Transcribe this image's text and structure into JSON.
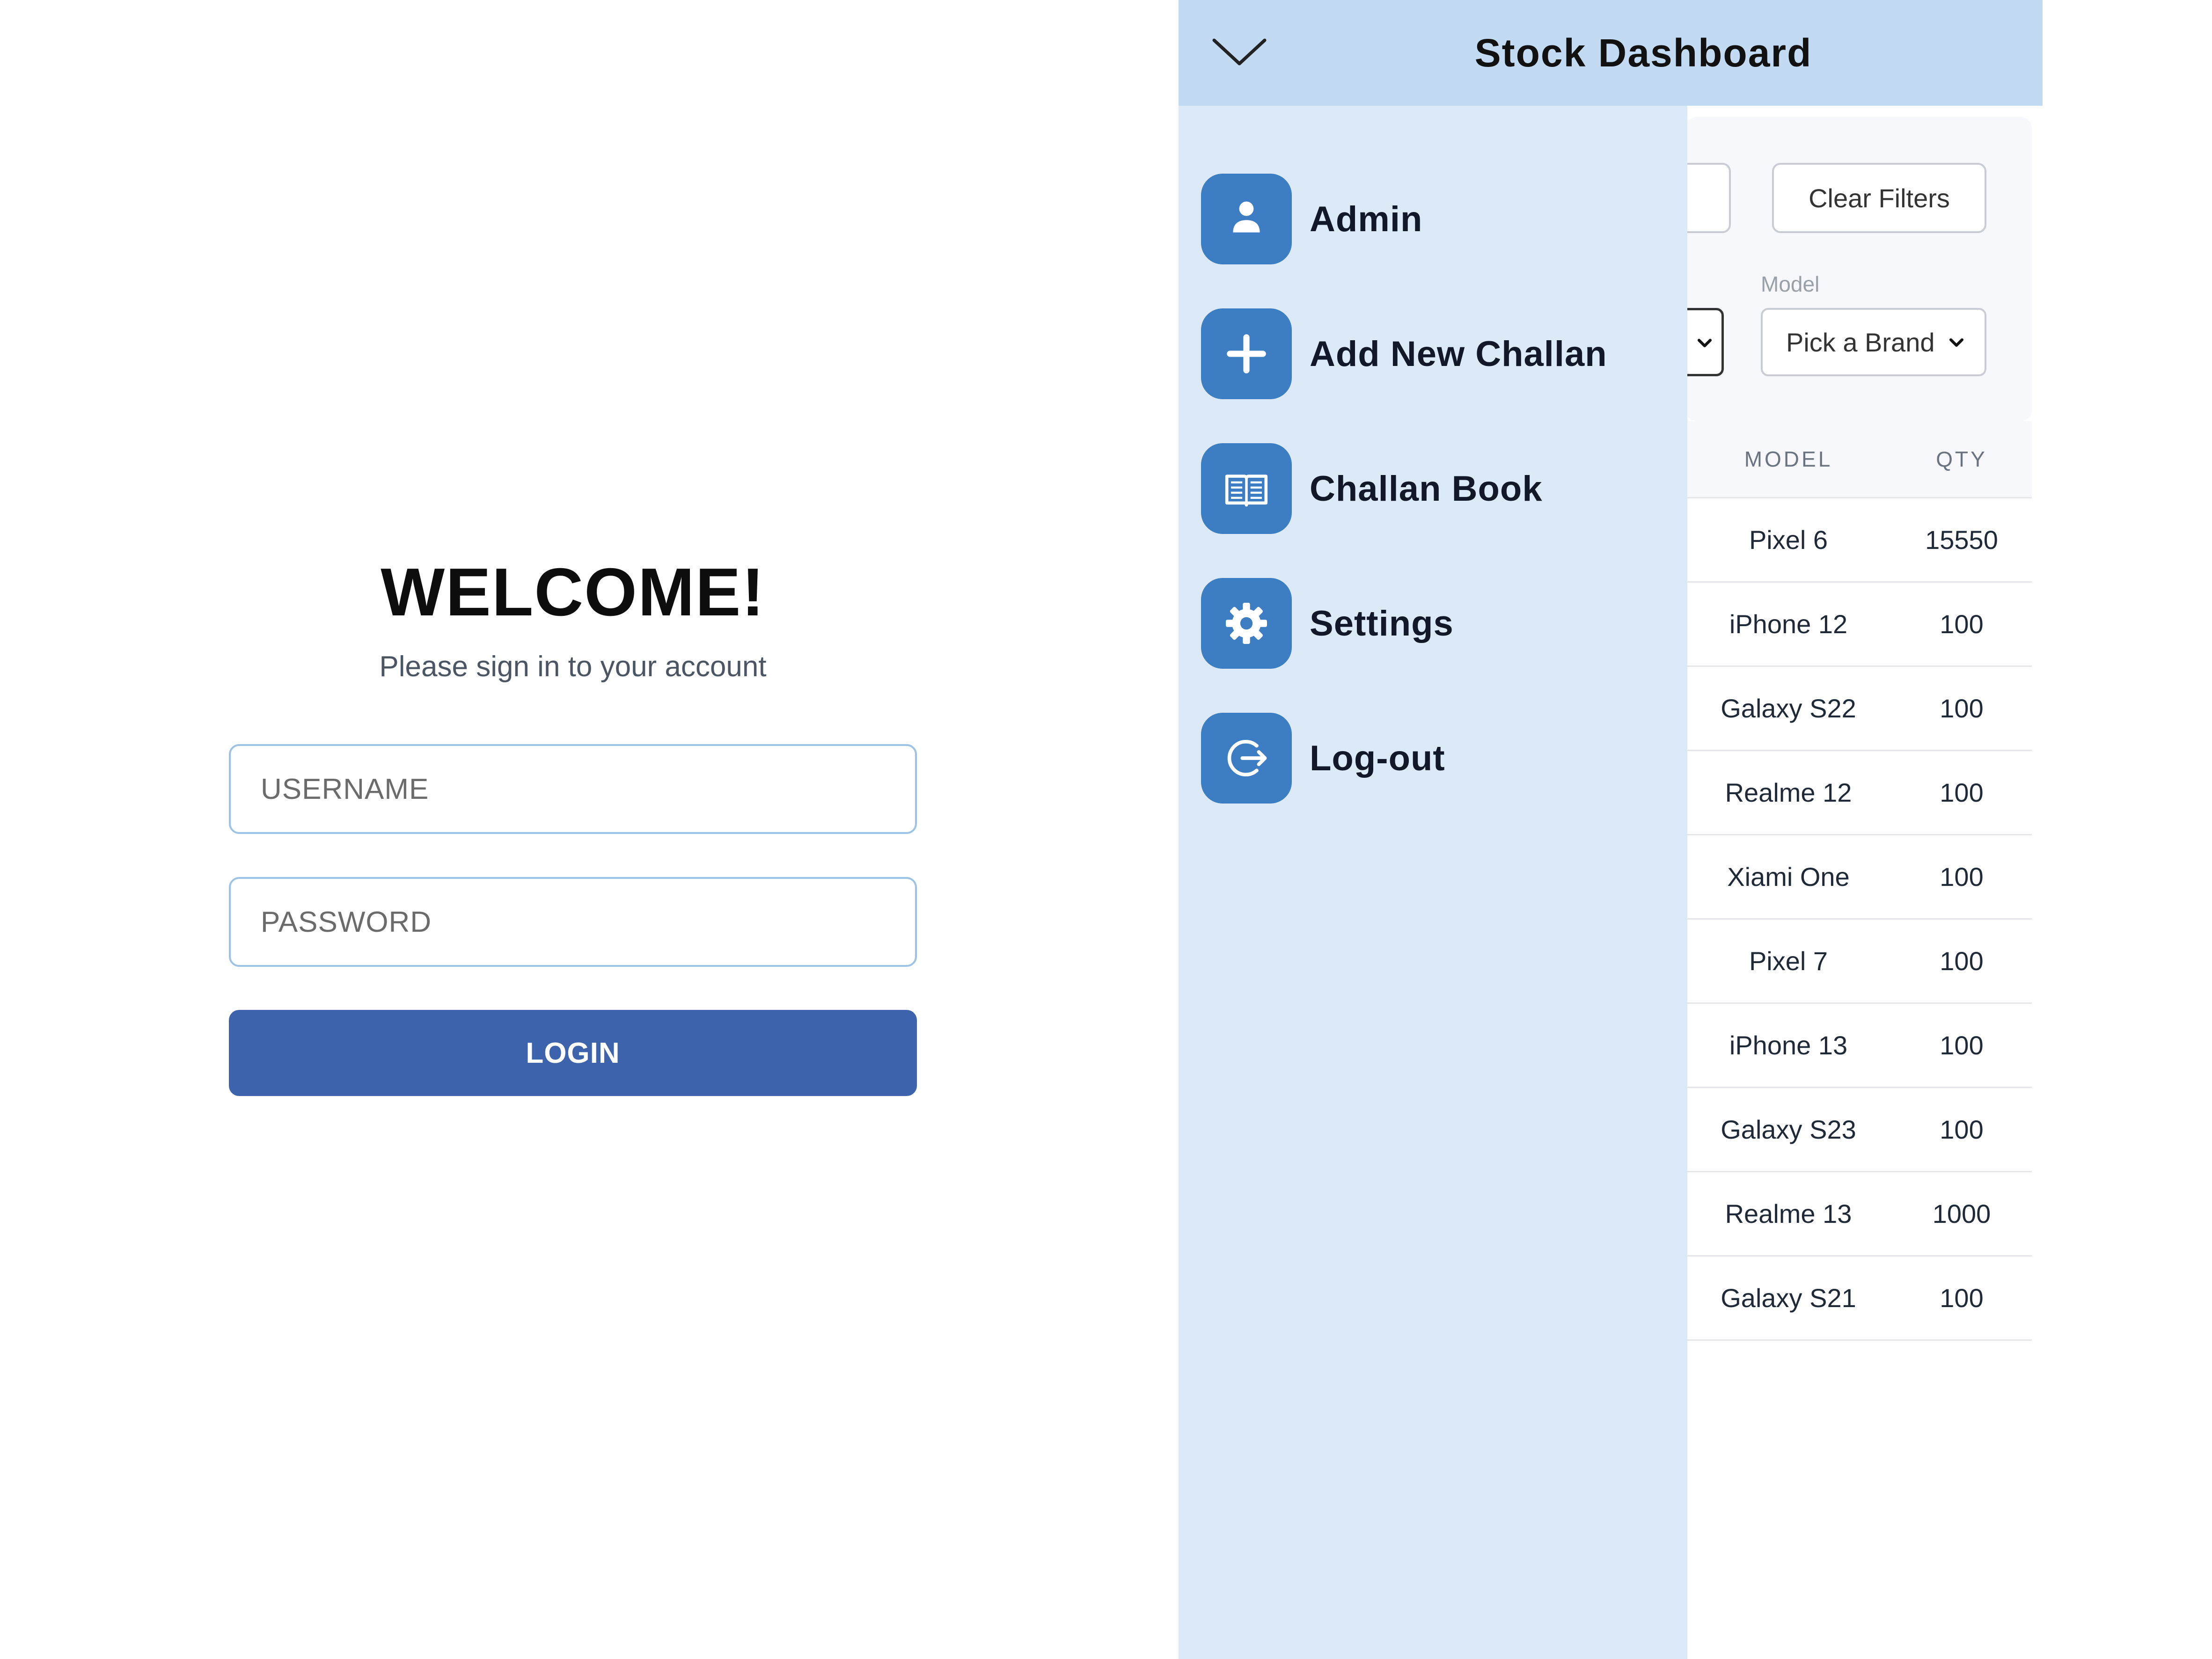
{
  "login": {
    "welcome": "WELCOME!",
    "subtitle": "Please sign in to your account",
    "username_placeholder": "USERNAME",
    "password_placeholder": "PASSWORD",
    "login_label": "LOGIN"
  },
  "dashboard": {
    "title": "Stock Dashboard",
    "clear_filters_label": "Clear Filters",
    "model_label": "Model",
    "model_select_value": "Pick a Brand",
    "table": {
      "headers": {
        "model": "MODEL",
        "qty": "QTY"
      },
      "rows": [
        {
          "model": "Pixel 6",
          "qty": "15550"
        },
        {
          "model": "iPhone 12",
          "qty": "100"
        },
        {
          "model": "Galaxy S22",
          "qty": "100"
        },
        {
          "model": "Realme 12",
          "qty": "100"
        },
        {
          "model": "Xiami One",
          "qty": "100"
        },
        {
          "model": "Pixel 7",
          "qty": "100"
        },
        {
          "model": "iPhone 13",
          "qty": "100"
        },
        {
          "model": "Galaxy S23",
          "qty": "100"
        },
        {
          "model": "Realme 13",
          "qty": "1000"
        },
        {
          "model": "Galaxy S21",
          "qty": "100"
        }
      ]
    }
  },
  "drawer": {
    "items": [
      {
        "label": "Admin",
        "icon": "user-icon"
      },
      {
        "label": "Add New Challan",
        "icon": "plus-icon"
      },
      {
        "label": "Challan Book",
        "icon": "book-icon"
      },
      {
        "label": "Settings",
        "icon": "gear-icon"
      },
      {
        "label": "Log-out",
        "icon": "logout-icon"
      }
    ]
  },
  "colors": {
    "login_button": "#3d63ad",
    "topbar": "#c2dbf2",
    "drawer": "#dceaf7",
    "menu_icon_bg": "#3d7dc4",
    "input_border": "#9cc2e5"
  }
}
